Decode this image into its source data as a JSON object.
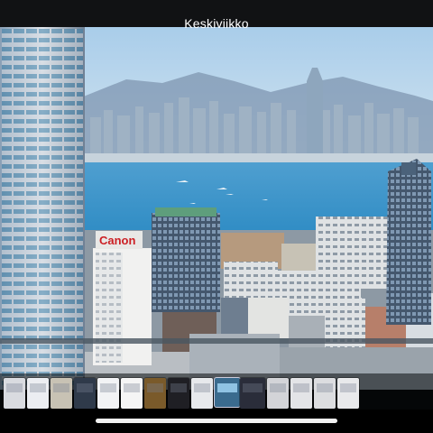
{
  "header": {
    "title": "Keskiviikko"
  },
  "photo": {
    "description_icon": "city-photo",
    "sign_text": "Canon"
  },
  "thumbnails": [
    {
      "name": "thumb-1",
      "icon": "app-screenshot",
      "color": "#d9dbe0"
    },
    {
      "name": "thumb-2",
      "icon": "app-screenshot",
      "color": "#eceef2"
    },
    {
      "name": "thumb-3",
      "icon": "app-screenshot",
      "color": "#c8c2b4"
    },
    {
      "name": "thumb-4",
      "icon": "app-screenshot",
      "color": "#2f3a4a"
    },
    {
      "name": "thumb-5",
      "icon": "app-screenshot",
      "color": "#f2f3f5"
    },
    {
      "name": "thumb-6",
      "icon": "app-screenshot",
      "color": "#f5f5f5"
    },
    {
      "name": "thumb-7",
      "icon": "app-screenshot",
      "color": "#7a5a2a"
    },
    {
      "name": "thumb-8",
      "icon": "app-screenshot",
      "color": "#1f1f24"
    },
    {
      "name": "thumb-9",
      "icon": "app-screenshot",
      "color": "#e7e9ec"
    },
    {
      "name": "thumb-10",
      "icon": "city-photo",
      "color": "#3a6b8e",
      "selected": true
    },
    {
      "name": "thumb-11",
      "icon": "app-screenshot",
      "color": "#2a2d3a"
    },
    {
      "name": "thumb-12",
      "icon": "app-screenshot",
      "color": "#d3d4d8"
    },
    {
      "name": "thumb-13",
      "icon": "app-screenshot",
      "color": "#e3e4e7"
    },
    {
      "name": "thumb-14",
      "icon": "app-screenshot",
      "color": "#dcdde0"
    },
    {
      "name": "thumb-15",
      "icon": "app-screenshot",
      "color": "#e8e9eb"
    }
  ],
  "colors": {
    "sky": "#b9d8ee",
    "water": "#5aa8d3",
    "background": "#000000",
    "indicator": "#f2f2f2"
  }
}
